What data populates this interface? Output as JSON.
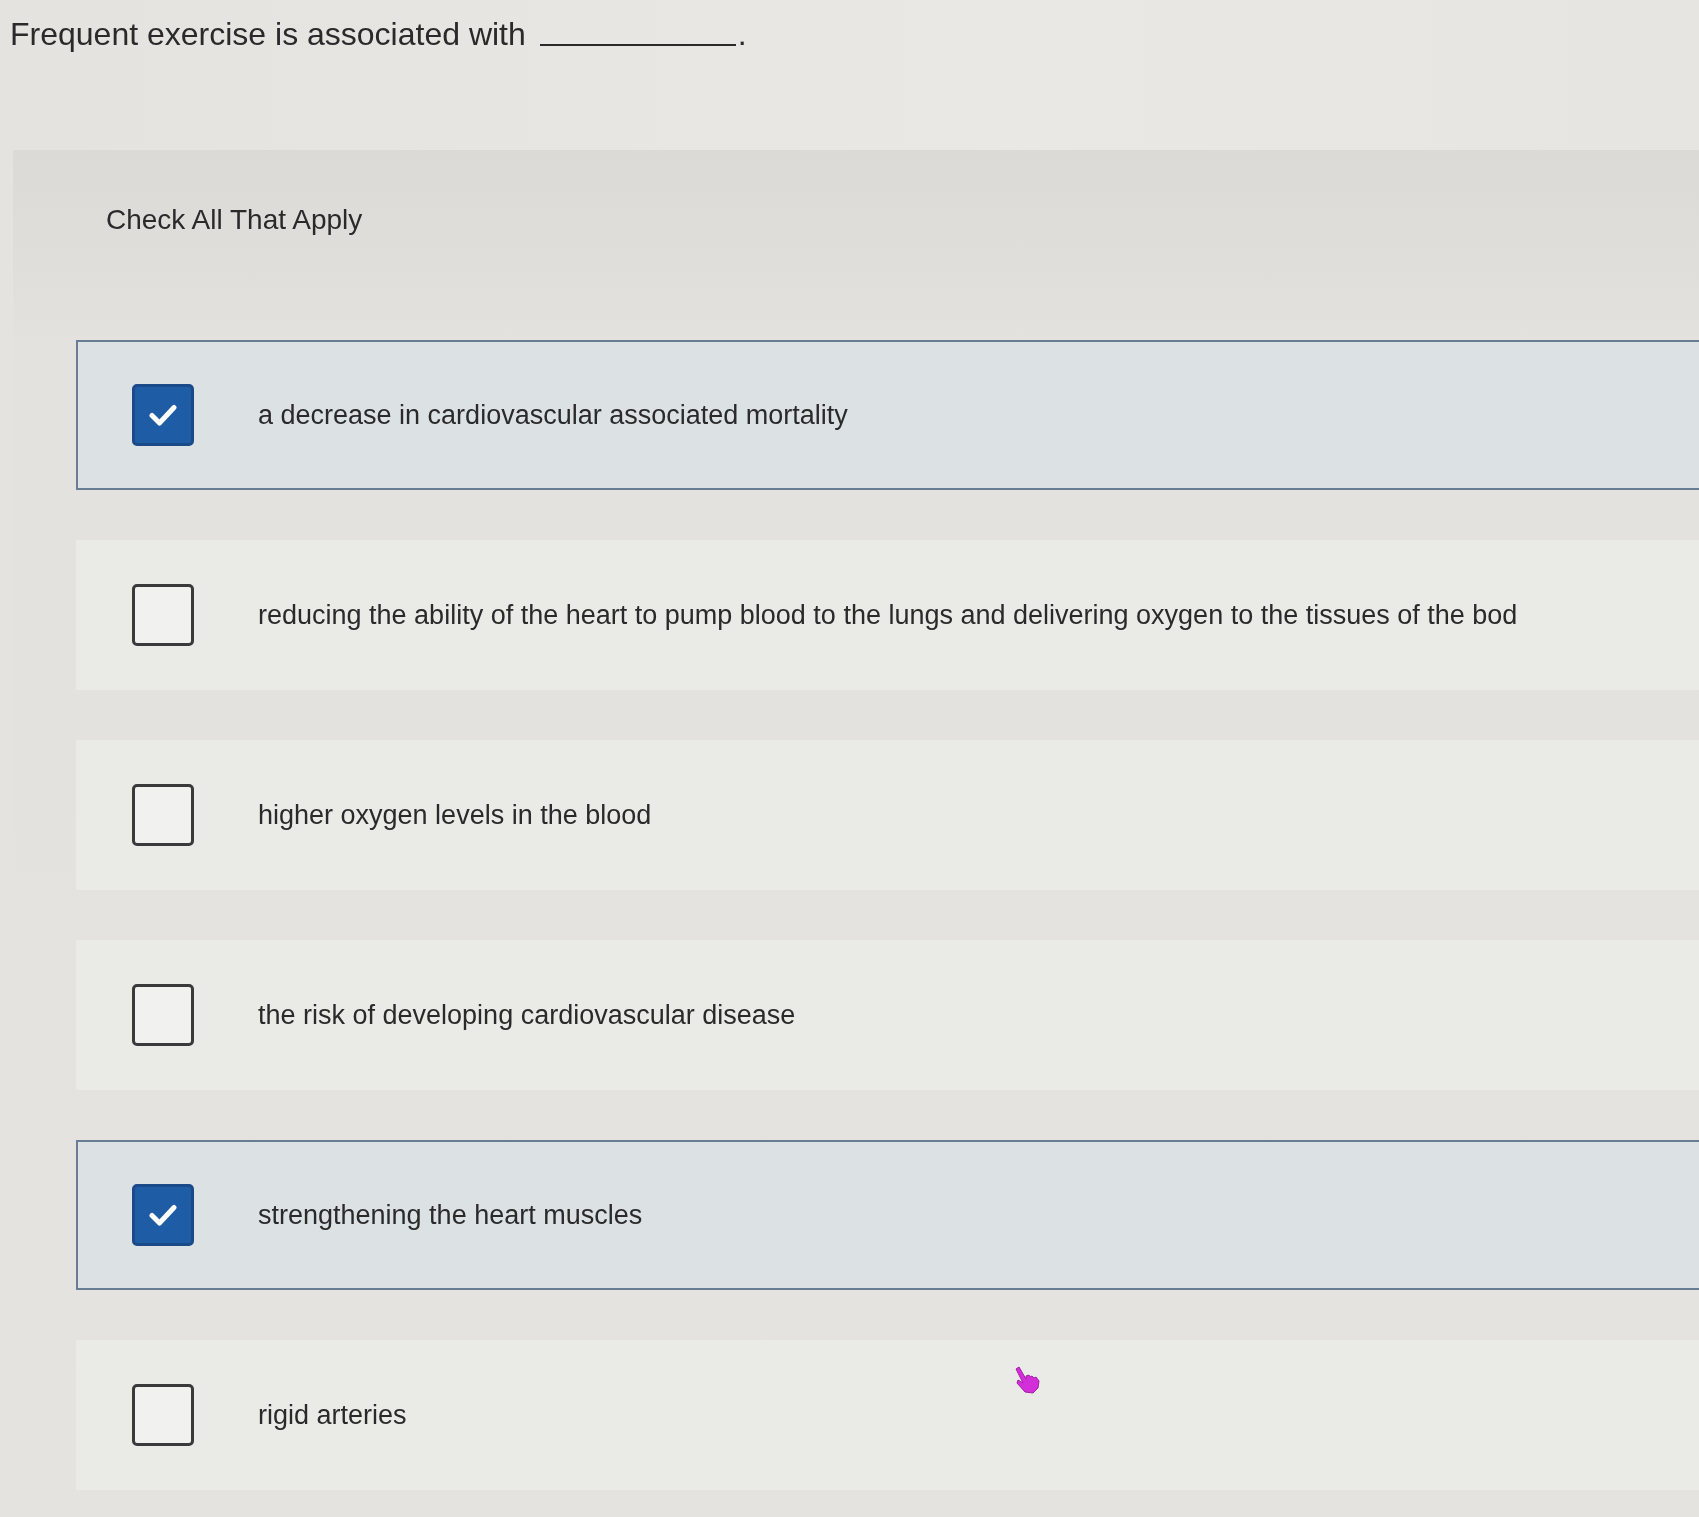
{
  "question": {
    "text": "Frequent exercise is associated with",
    "after_blank": "."
  },
  "instruction": "Check All That Apply",
  "options": [
    {
      "label": "a decrease in cardiovascular associated mortality",
      "checked": true
    },
    {
      "label": "reducing the ability of the heart to pump blood to the lungs and delivering oxygen to the tissues of the bod",
      "checked": false
    },
    {
      "label": "higher oxygen levels in the blood",
      "checked": false
    },
    {
      "label": "the risk of developing cardiovascular disease",
      "checked": false
    },
    {
      "label": "strengthening the heart muscles",
      "checked": true
    },
    {
      "label": "rigid arteries",
      "checked": false
    }
  ]
}
